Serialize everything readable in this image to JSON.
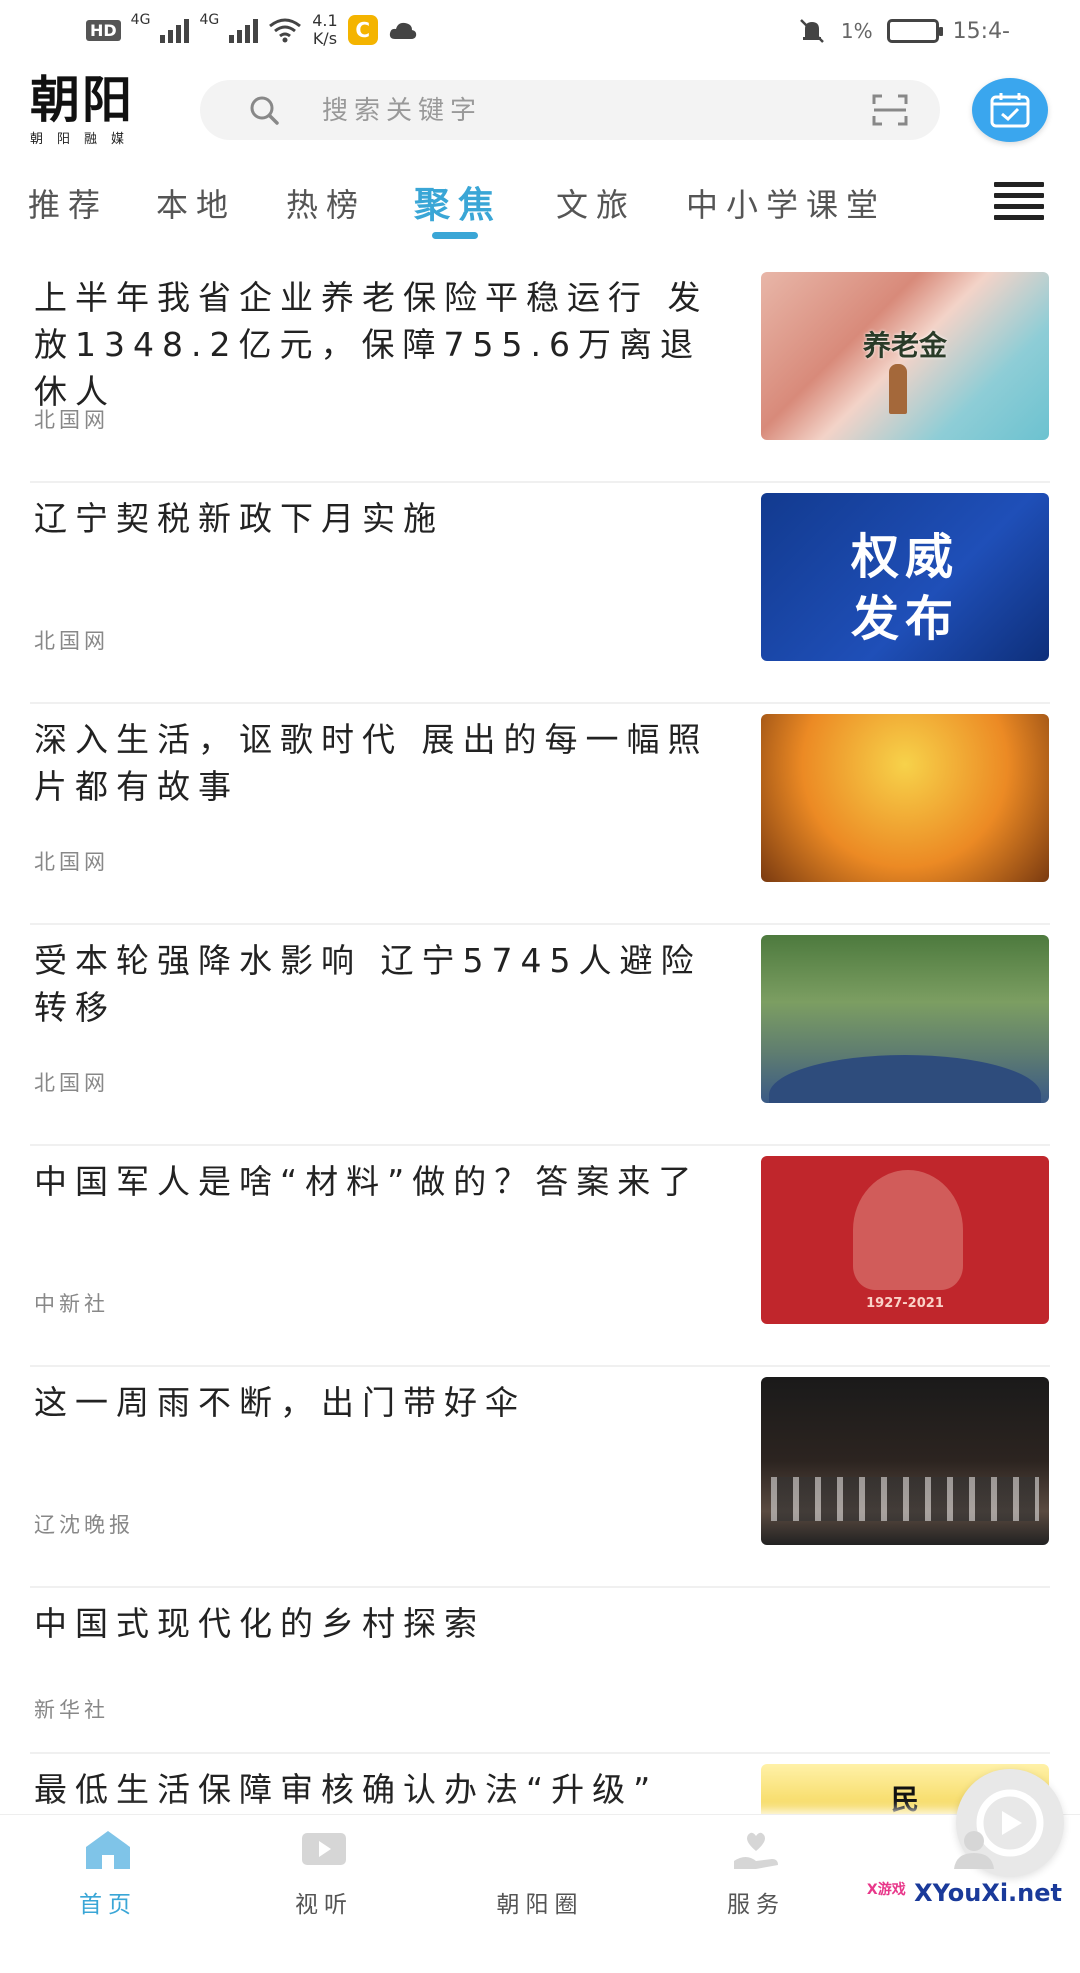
{
  "status_bar": {
    "network_badge": "HD",
    "signal_1": "4G",
    "signal_2": "4G",
    "net_speed_value": "4.1",
    "net_speed_unit": "K/s",
    "app_icon_label": "C",
    "battery_percent": "1%",
    "time": "15:4-"
  },
  "header": {
    "logo_title": "朝阳",
    "logo_subtitle": "朝阳融媒",
    "search_placeholder": "搜索关键字"
  },
  "tabs": [
    {
      "label": "推荐",
      "active": false
    },
    {
      "label": "本地",
      "active": false
    },
    {
      "label": "热榜",
      "active": false
    },
    {
      "label": "聚焦",
      "active": true
    },
    {
      "label": "文旅",
      "active": false
    },
    {
      "label": "中小学课堂",
      "active": false
    }
  ],
  "news": [
    {
      "title": "上半年我省企业养老保险平稳运行 发放1348.2亿元，保障755.6万离退休人",
      "source": "北国网",
      "image_text": "养老金"
    },
    {
      "title": "辽宁契税新政下月实施",
      "source": "北国网",
      "image_text_line1": "权威",
      "image_text_line2": "发布"
    },
    {
      "title": "深入生活，讴歌时代 展出的每一幅照片都有故事",
      "source": "北国网"
    },
    {
      "title": "受本轮强降水影响 辽宁5745人避险转移",
      "source": "北国网"
    },
    {
      "title": "中国军人是啥“材料”做的？答案来了",
      "source": "中新社",
      "image_text": "1927-2021"
    },
    {
      "title": "这一周雨不断，出门带好伞",
      "source": "辽沈晚报"
    },
    {
      "title": "中国式现代化的乡村探索",
      "source": "新华社"
    },
    {
      "title": "最低生活保障审核确认办法“升级”",
      "image_text": "民"
    }
  ],
  "bottom_nav": [
    {
      "label": "首页",
      "active": true
    },
    {
      "label": "视听",
      "active": false
    },
    {
      "label": "朝阳圈",
      "active": false
    },
    {
      "label": "服务",
      "active": false
    }
  ],
  "watermark": {
    "brand": "XYouXi.net",
    "tag": "X游戏"
  },
  "colors": {
    "accent": "#3aa6d6",
    "calendar_button": "#3aa6ee",
    "text": "#222222",
    "source_text": "#888888"
  }
}
